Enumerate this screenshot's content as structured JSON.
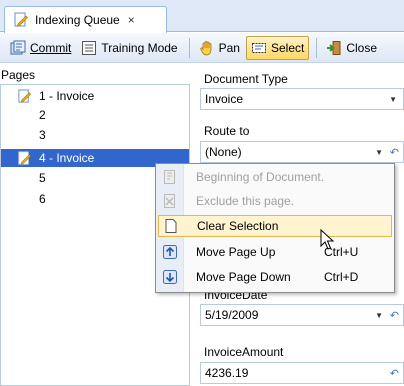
{
  "tab": {
    "title": "Indexing Queue",
    "close": "×"
  },
  "toolbar": {
    "commit": "Commit",
    "training_mode": "Training Mode",
    "pan": "Pan",
    "select": "Select",
    "close": "Close"
  },
  "pages": {
    "title": "Pages",
    "items": [
      {
        "label": "1 - Invoice",
        "icon": "document-pencil-icon"
      },
      {
        "label": "2"
      },
      {
        "label": "3"
      },
      {
        "label": "4 - Invoice",
        "icon": "document-pencil-icon",
        "selected": true
      },
      {
        "label": "5"
      },
      {
        "label": "6"
      }
    ]
  },
  "fields": {
    "document_type_label": "Document Type",
    "document_type_value": "Invoice",
    "route_to_label": "Route to",
    "route_to_value": "(None)",
    "invoice_date_label": "InvoiceDate",
    "invoice_date_value": "5/19/2009",
    "invoice_amount_label": "InvoiceAmount",
    "invoice_amount_value": "4236.19"
  },
  "context_menu": {
    "items": [
      {
        "label": "Beginning of Document.",
        "enabled": false
      },
      {
        "label": "Exclude this page.",
        "enabled": false
      },
      {
        "label": "Clear Selection",
        "hover": true
      },
      {
        "label": "Move Page Up",
        "shortcut": "Ctrl+U"
      },
      {
        "label": "Move Page Down",
        "shortcut": "Ctrl+D"
      }
    ]
  },
  "colors": {
    "selection": "#3366cc",
    "accent": "#99bbe8",
    "hover": "#fff4cf"
  }
}
